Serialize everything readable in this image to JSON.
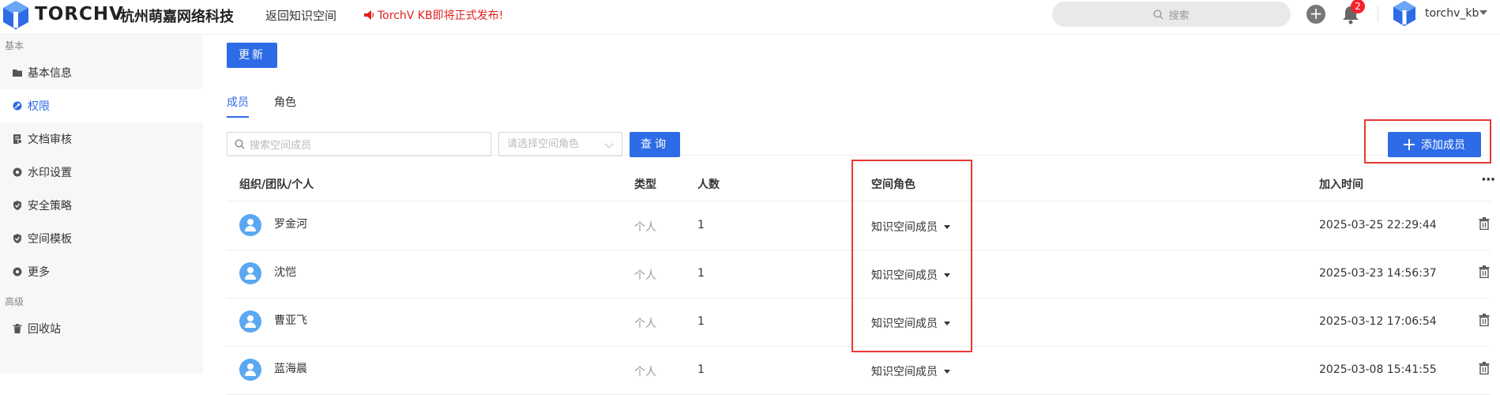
{
  "header": {
    "brand": "TORCHV",
    "company": "杭州萌嘉网络科技",
    "back_link": "返回知识空间",
    "announcement": "TorchV KB即将正式发布!",
    "search_placeholder": "搜索",
    "notification_count": "2",
    "username": "torchv_kb"
  },
  "sidebar": {
    "section_basic": "基本",
    "section_advanced": "高级",
    "items": [
      {
        "label": "基本信息",
        "icon": "folder-icon"
      },
      {
        "label": "权限",
        "icon": "key-icon",
        "active": true
      },
      {
        "label": "文档审核",
        "icon": "document-review-icon"
      },
      {
        "label": "水印设置",
        "icon": "watermark-icon"
      },
      {
        "label": "安全策略",
        "icon": "shield-icon"
      },
      {
        "label": "空间模板",
        "icon": "shield-template-icon"
      },
      {
        "label": "更多",
        "icon": "more-circle-icon"
      }
    ],
    "recycle": {
      "label": "回收站",
      "icon": "trash-icon"
    }
  },
  "main": {
    "update_button": "更新",
    "tabs": [
      {
        "label": "成员",
        "active": true
      },
      {
        "label": "角色"
      }
    ],
    "search_placeholder": "搜索空间成员",
    "role_select_placeholder": "请选择空间角色",
    "query_button": "查询",
    "add_member_button": "添加成员",
    "columns": {
      "org": "组织/团队/个人",
      "type": "类型",
      "count": "人数",
      "role": "空间角色",
      "joined": "加入时间"
    },
    "rows": [
      {
        "name": "罗金河",
        "type": "个人",
        "count": "1",
        "role": "知识空间成员",
        "joined": "2025-03-25 22:29:44"
      },
      {
        "name": "沈恺",
        "type": "个人",
        "count": "1",
        "role": "知识空间成员",
        "joined": "2025-03-23 14:56:37"
      },
      {
        "name": "曹亚飞",
        "type": "个人",
        "count": "1",
        "role": "知识空间成员",
        "joined": "2025-03-12 17:06:54"
      },
      {
        "name": "蓝海晨",
        "type": "个人",
        "count": "1",
        "role": "知识空间成员",
        "joined": "2025-03-08 15:41:55"
      }
    ]
  },
  "colors": {
    "accent": "#2e6be6",
    "highlight": "#e53935",
    "announcement": "#e02020",
    "badge": "#f5222d"
  }
}
